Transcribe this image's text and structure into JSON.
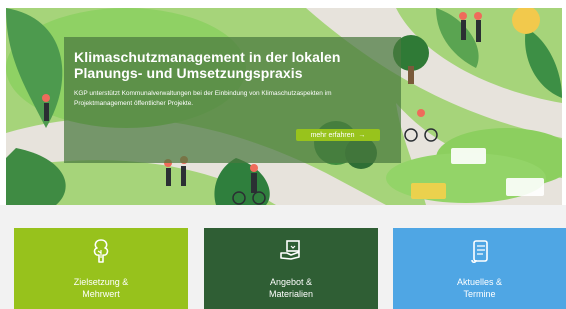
{
  "colors": {
    "overlay": "#49783f",
    "cta": "#98c31c",
    "card1": "#97c21c",
    "card2": "#2f5e34",
    "card3": "#4fa6e4",
    "section_bg": "#f2f2f2"
  },
  "hero": {
    "title": "Klimaschutzmanagement in der lokalen Planungs- und Umsetzungspraxis",
    "description": "KGP unterstützt Kommunalverwaltungen bei der Einbindung von Klimaschutzaspekten im Projektmanagement öffentlicher Projekte.",
    "cta_label": "mehr erfahren",
    "cta_icon": "arrow-right-icon"
  },
  "cards": [
    {
      "label_line1": "Zielsetzung &",
      "label_line2": "Mehrwert",
      "icon": "tree-icon"
    },
    {
      "label_line1": "Angebot &",
      "label_line2": "Materialien",
      "icon": "hand-with-box-icon"
    },
    {
      "label_line1": "Aktuelles &",
      "label_line2": "Termine",
      "icon": "scroll-icon"
    }
  ]
}
